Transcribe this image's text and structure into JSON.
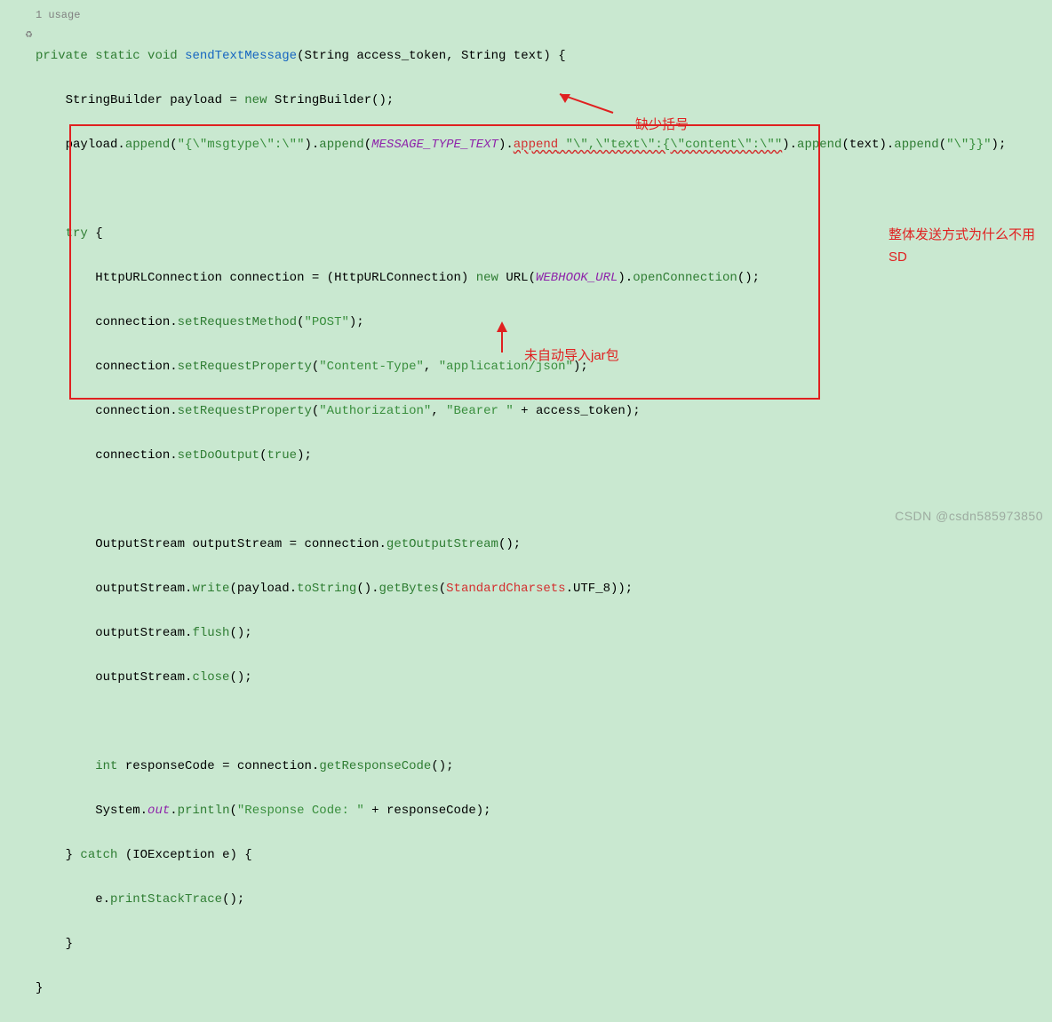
{
  "usage": "1 usage",
  "code": {
    "sig_private": "private",
    "sig_static": "static",
    "sig_void": "void",
    "method_name": "sendTextMessage",
    "param1_type": "String",
    "param1_name": "access_token",
    "param2_type": "String",
    "param2_name": "text",
    "l2_type": "StringBuilder",
    "l2_var": "payload",
    "l2_new": "new",
    "l2_ctor": "StringBuilder",
    "l3_var": "payload",
    "l3_append1": "append",
    "l3_str1": "\"{\\\"msgtype\\\":\\\"\"",
    "l3_append2": "append",
    "l3_const1": "MESSAGE_TYPE_TEXT",
    "l3_append3": "append",
    "l3_err_str": " \"\\\",\\\"text\\\":{\\\"content\\\":\\\"\"",
    "l3_append4": "append",
    "l3_text": "text",
    "l3_append5": "append",
    "l3_str3": "\"\\\"}}\"",
    "try_kw": "try",
    "l5_type": "HttpURLConnection",
    "l5_var": "connection",
    "l5_cast": "HttpURLConnection",
    "l5_new": "new",
    "l5_url": "URL",
    "l5_const": "WEBHOOK_URL",
    "l5_open": "openConnection",
    "l6_conn": "connection",
    "l6_m": "setRequestMethod",
    "l6_s": "\"POST\"",
    "l7_conn": "connection",
    "l7_m": "setRequestProperty",
    "l7_s1": "\"Content-Type\"",
    "l7_s2": "\"application/json\"",
    "l8_conn": "connection",
    "l8_m": "setRequestProperty",
    "l8_s1": "\"Authorization\"",
    "l8_s2": "\"Bearer \"",
    "l8_tok": "access_token",
    "l9_conn": "connection",
    "l9_m": "setDoOutput",
    "l9_true": "true",
    "l11_type": "OutputStream",
    "l11_var": "outputStream",
    "l11_conn": "connection",
    "l11_m": "getOutputStream",
    "l12_os": "outputStream",
    "l12_write": "write",
    "l12_payload": "payload",
    "l12_tostr": "toString",
    "l12_getbytes": "getBytes",
    "l12_charset": "StandardCharsets",
    "l12_utf8": "UTF_8",
    "l13_os": "outputStream",
    "l13_flush": "flush",
    "l14_os": "outputStream",
    "l14_close": "close",
    "l16_int": "int",
    "l16_var": "responseCode",
    "l16_conn": "connection",
    "l16_m": "getResponseCode",
    "l17_sys": "System",
    "l17_out": "out",
    "l17_println": "println",
    "l17_str": "\"Response Code: \"",
    "l17_var": "responseCode",
    "catch_kw": "catch",
    "catch_type": "IOException",
    "catch_var": "e",
    "l19_e": "e",
    "l19_m": "printStackTrace"
  },
  "annotations": {
    "missing_bracket": "缺少括号",
    "not_imported": "未自动导入jar包",
    "why_not_sdk": "整体发送方式为什么不用SD"
  },
  "watermark": "CSDN @csdn585973850"
}
